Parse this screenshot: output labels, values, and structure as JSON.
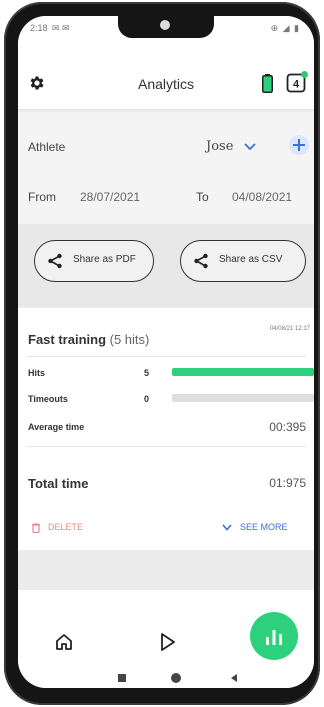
{
  "status_bar": {
    "time": "2:18",
    "left_icons": "✉ ✉",
    "right_icons": "⊕ ◢ ▮"
  },
  "app_bar": {
    "title": "Analytics",
    "icons": [
      "gear-icon",
      "battery-icon",
      "notification-icon"
    ]
  },
  "filters": {
    "athlete_label": "Athlete",
    "athlete_value": "Jose",
    "from_label": "From",
    "from_value": "28/07/2021",
    "to_label": "To",
    "to_value": "04/08/2021"
  },
  "share": {
    "pdf_label": "Share as PDF",
    "csv_label": "Share as CSV"
  },
  "session": {
    "title": "Fast training",
    "hits_summary": "(5 hits)",
    "date": "04/08/21 12:17",
    "stats": [
      {
        "label": "Hits",
        "value": "5",
        "fill": 1.0
      },
      {
        "label": "Timeouts",
        "value": "0",
        "fill": 0.0
      }
    ],
    "average_label": "Average time",
    "average_value": "00:395",
    "total_label": "Total time",
    "total_value": "01:975",
    "delete_label": "DELETE",
    "see_more_label": "SEE MORE"
  },
  "nav": {
    "items": [
      "home-icon",
      "play-icon",
      "analytics-icon"
    ],
    "active": "analytics"
  },
  "colors": {
    "accent_green": "#2dd17d",
    "link_blue": "#3d6fd8",
    "delete_red": "#e88a8a",
    "plus_bg": "#dbe6ff"
  }
}
